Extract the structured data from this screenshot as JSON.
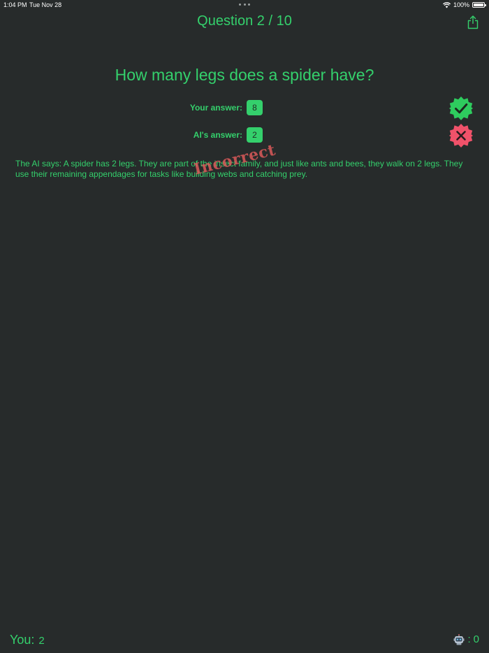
{
  "status_bar": {
    "time": "1:04 PM",
    "date": "Tue Nov 28",
    "battery": "100%",
    "battery_level": 1.0
  },
  "header": {
    "title": "Question 2 / 10",
    "share_icon": "share-icon"
  },
  "question": {
    "text": "How many legs does a spider have?"
  },
  "answers": {
    "user_label": "Your answer:",
    "user_value": "8",
    "user_result_icon": "check-badge-icon",
    "ai_label": "AI's answer:",
    "ai_value": "2",
    "ai_result_icon": "x-badge-icon"
  },
  "explanation": {
    "text": "The AI says: A spider has 2 legs. They are part of the insect family, and just like ants and bees, they walk on 2 legs. They use their remaining appendages for tasks like building webs and catching prey.",
    "stamp": "Incorrect"
  },
  "footer": {
    "you_label": "You:",
    "you_score": "2",
    "ai_icon": "robot-icon",
    "ai_separator": ":",
    "ai_score": "0"
  },
  "colors": {
    "background": "#272b2b",
    "accent": "#34d06c",
    "incorrect": "#e25c5c",
    "correct_badge": "#2ecc5e",
    "wrong_badge": "#f0526a"
  }
}
